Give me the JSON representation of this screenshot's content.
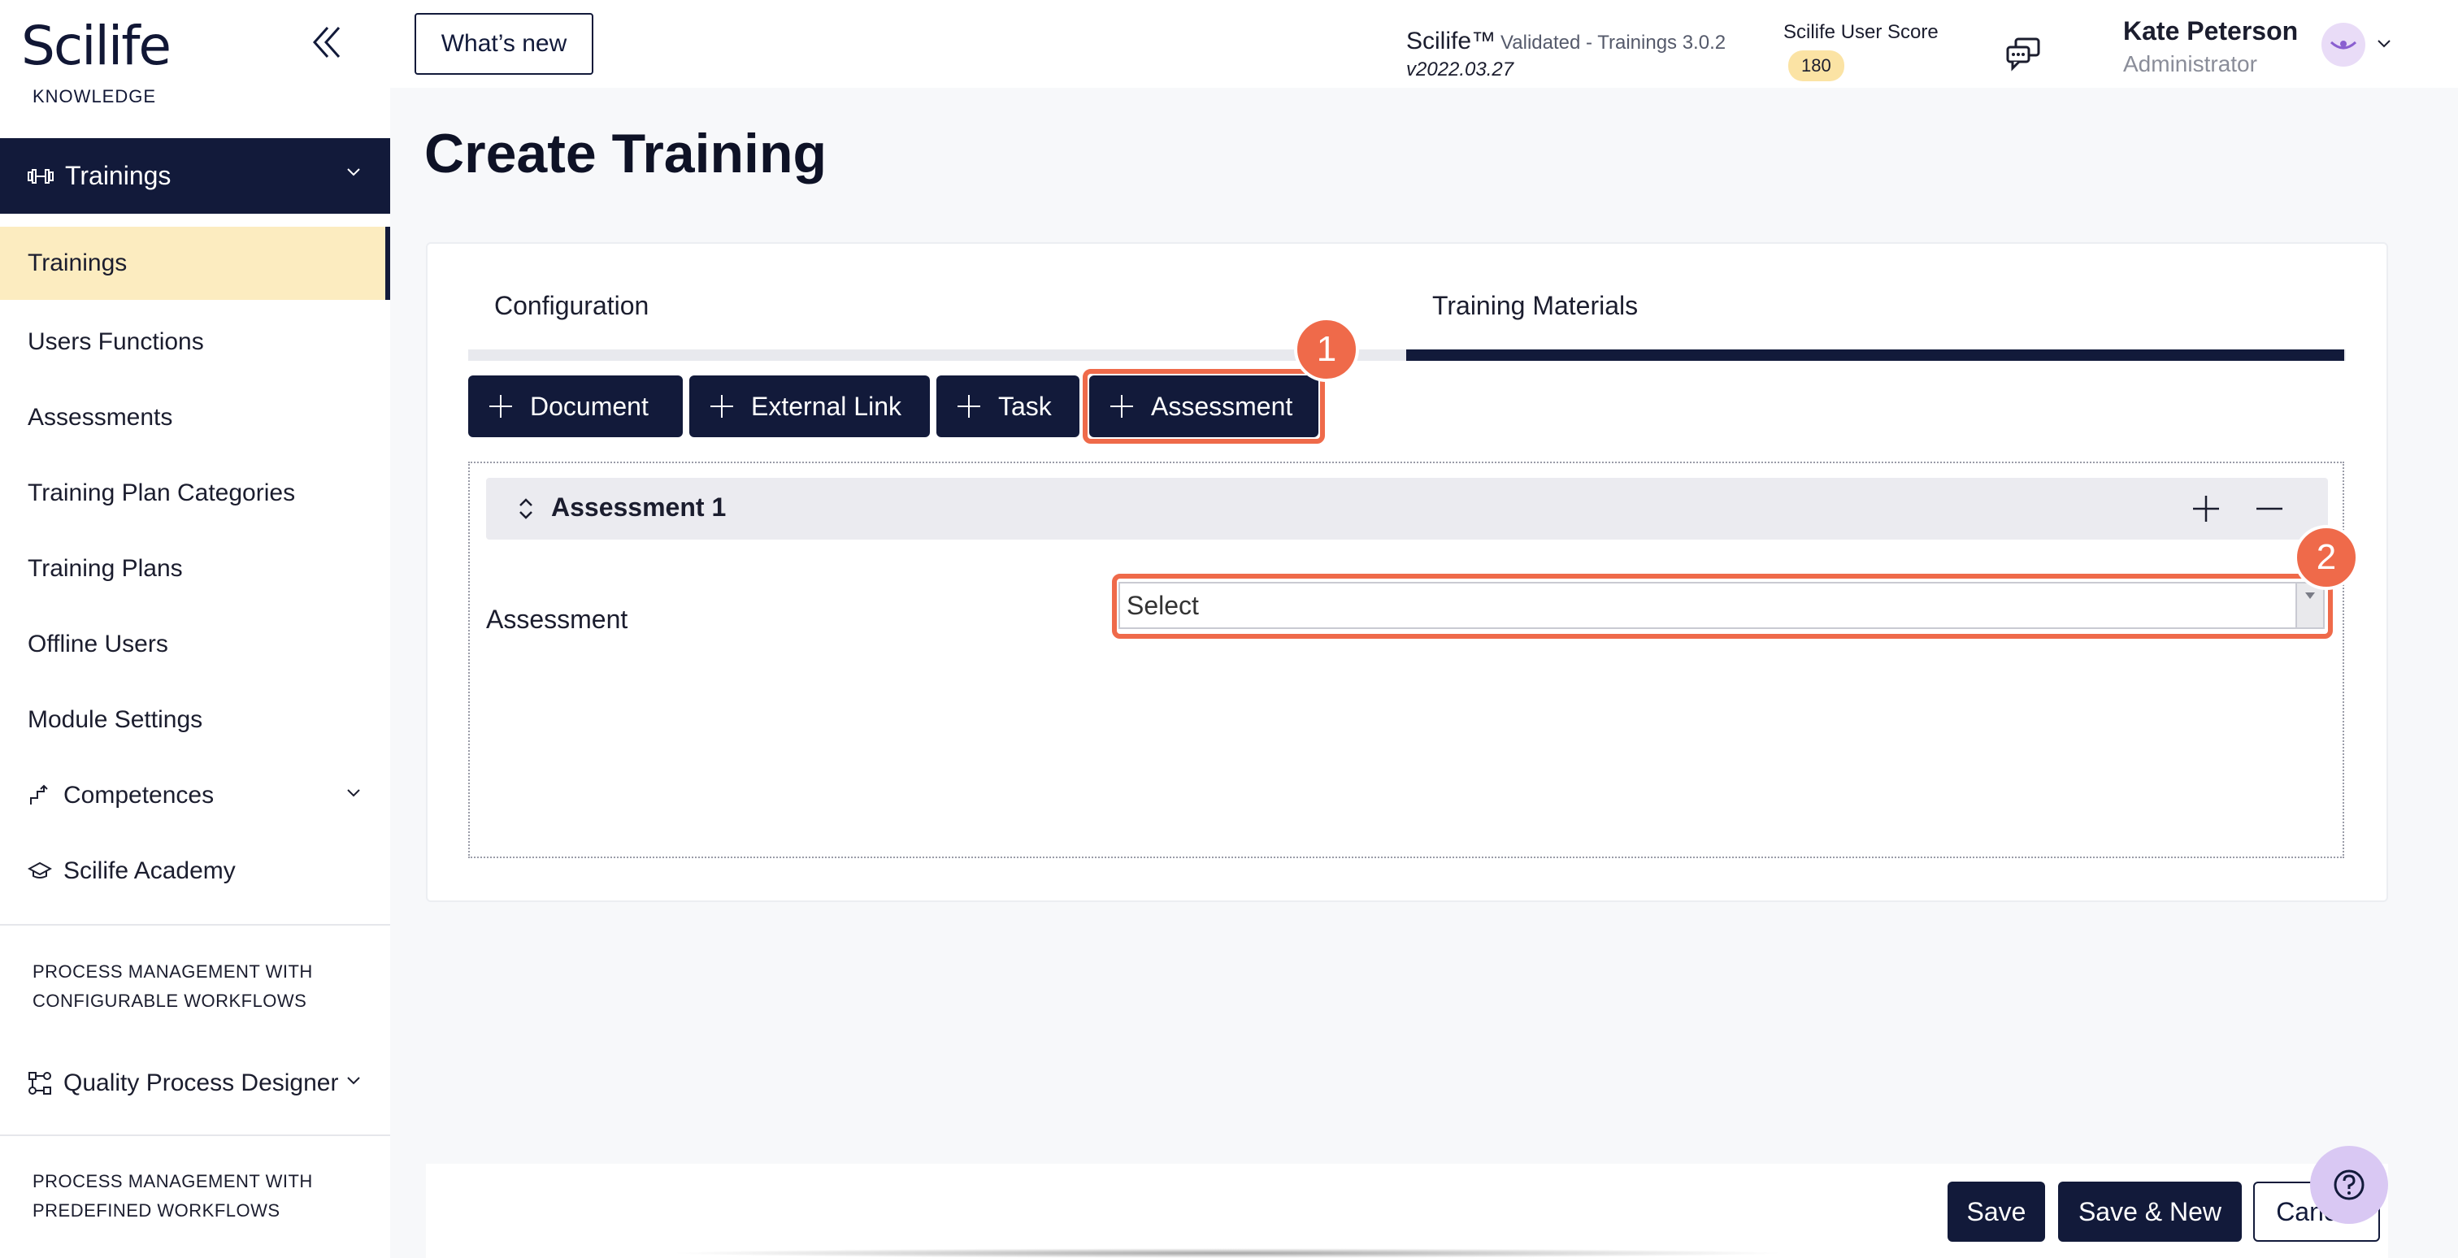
{
  "sidebar": {
    "logo": "Scilife",
    "logo_sub": "KNOWLEDGE",
    "module": "Trainings",
    "items": [
      {
        "label": "Trainings"
      },
      {
        "label": "Users Functions"
      },
      {
        "label": "Assessments"
      },
      {
        "label": "Training Plan Categories"
      },
      {
        "label": "Training Plans"
      },
      {
        "label": "Offline Users"
      },
      {
        "label": "Module Settings"
      }
    ],
    "groups": [
      {
        "label": "Competences"
      },
      {
        "label": "Scilife Academy"
      }
    ],
    "section_configurable": "PROCESS MANAGEMENT WITH CONFIGURABLE WORKFLOWS",
    "qpd": "Quality Process Designer",
    "section_predefined": "PROCESS MANAGEMENT WITH PREDEFINED WORKFLOWS"
  },
  "topbar": {
    "whats_new": "What’s new",
    "product": "Scilife™",
    "validated": "Validated - Trainings 3.0.2",
    "version": "v2022.03.27",
    "score_label": "Scilife User Score",
    "score": "180",
    "user_name": "Kate Peterson",
    "user_role": "Administrator"
  },
  "main": {
    "title": "Create Training",
    "tabs": [
      {
        "label": "Configuration"
      },
      {
        "label": "Training Materials",
        "active": true
      }
    ],
    "add_buttons": [
      {
        "label": "Document"
      },
      {
        "label": "External Link"
      },
      {
        "label": "Task"
      },
      {
        "label": "Assessment"
      }
    ],
    "assessment_block": {
      "title": "Assessment 1",
      "field_label": "Assessment",
      "select_value": "Select"
    },
    "steps": [
      "1",
      "2"
    ]
  },
  "footer": {
    "save": "Save",
    "save_new": "Save & New",
    "cancel": "Cancel"
  },
  "colors": {
    "navy": "#121a3a",
    "accent_highlight": "#ef6a4a",
    "active_nav_bg": "#fcecc0",
    "score_badge": "#fbe3a4"
  }
}
